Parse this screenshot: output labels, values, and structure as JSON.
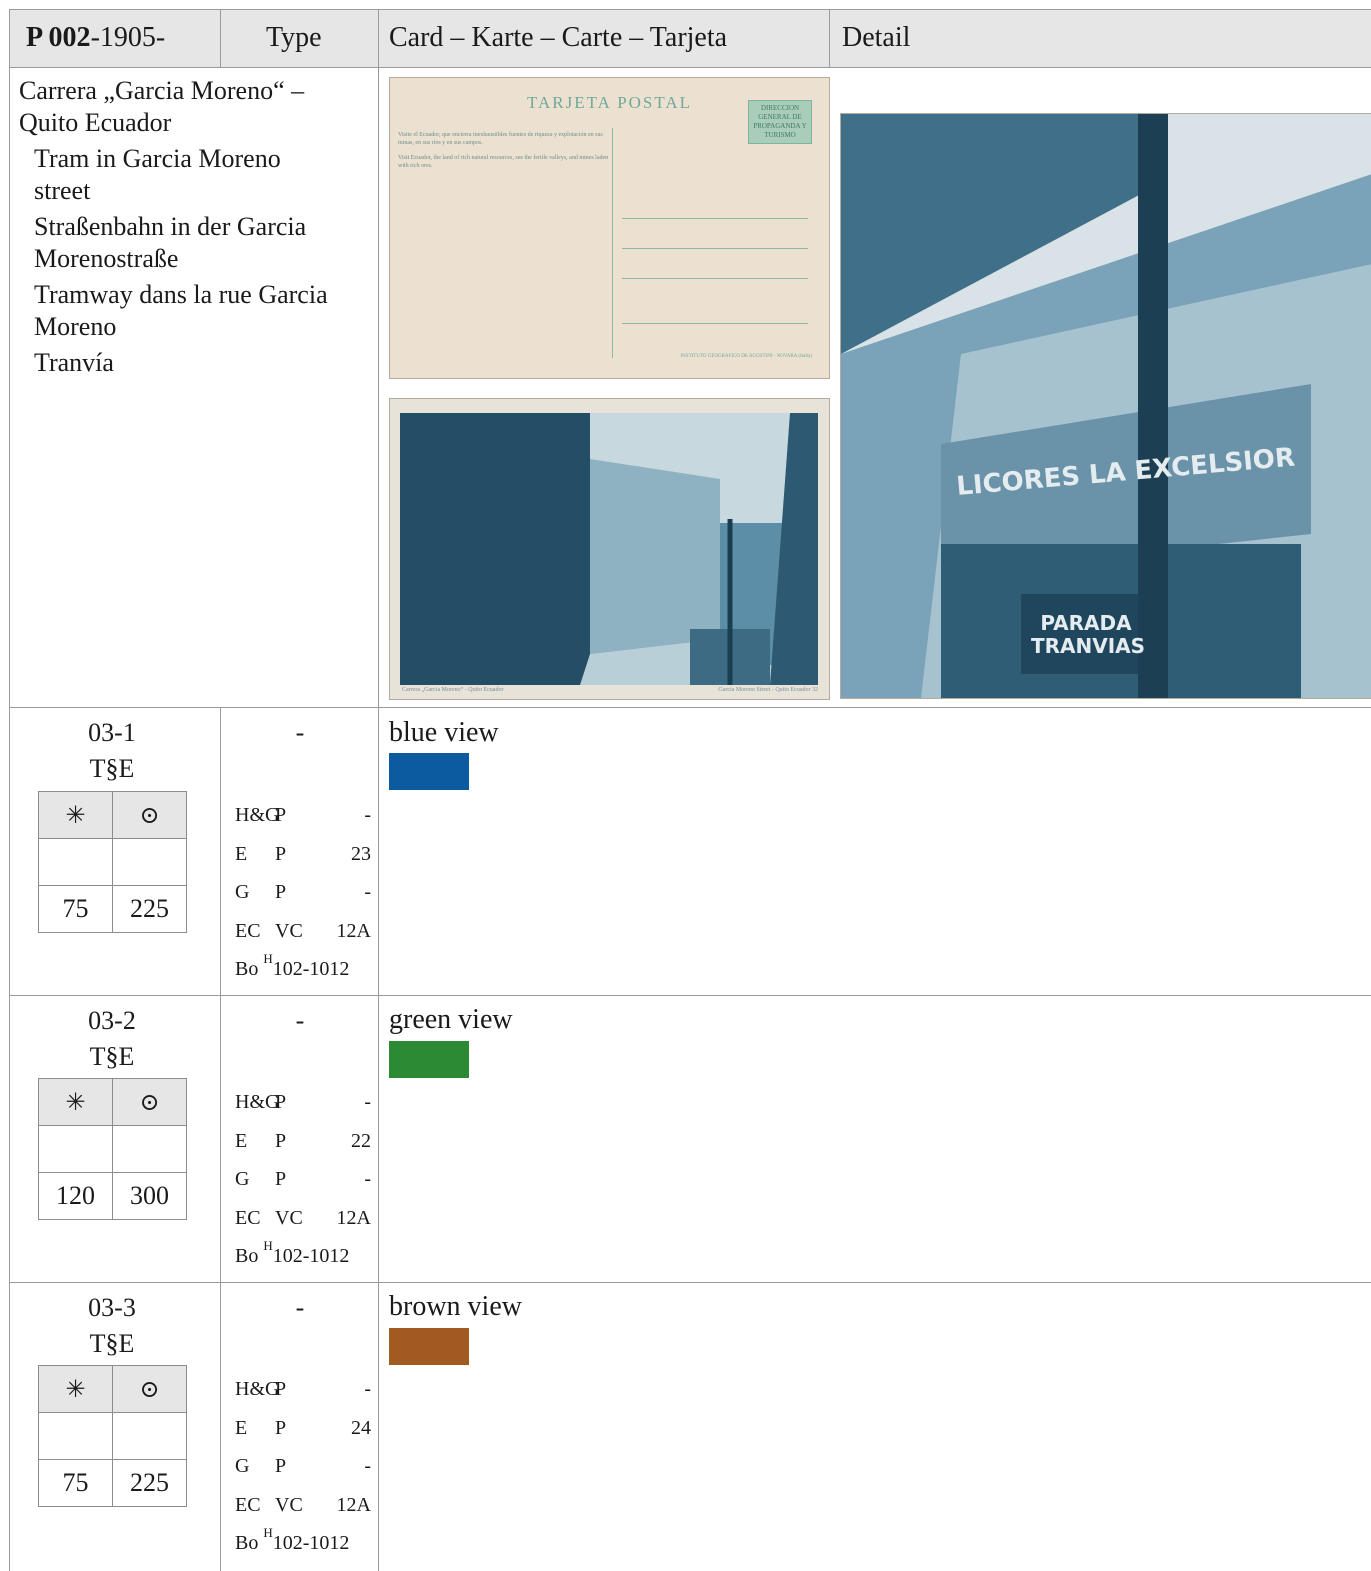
{
  "header": {
    "catalog_prefix": "P 002",
    "catalog_suffix": "-1905-",
    "type_label": "Type",
    "card_label": "Card – Karte – Carte – Tarjeta",
    "detail_label": "Detail"
  },
  "description": {
    "title_lines": [
      "Carrera „Garcia Moreno“ –",
      "Quito Ecuador"
    ],
    "translations": [
      [
        "Tram in Garcia Moreno",
        "street"
      ],
      [
        "Straßenbahn in der Garcia",
        "Morenostraße"
      ],
      [
        "Tramway dans la rue Garcia",
        "Moreno"
      ],
      [
        "Tranvía"
      ]
    ]
  },
  "postcard_back": {
    "title": "TARJETA POSTAL",
    "text_es": "Visite el Ecuador, que encierra inexhaustibles fuentes de riqueza y explotación en sus minas, en sus ríos y en sus campos.",
    "text_en": "Visit Ecuador, the land of rich natural resources, see the fertile valleys, and mines laden with rich ores.",
    "stamp_text": "DIRECCION GENERAL DE PROPAGANDA Y TURISMO",
    "footer": "INSTITUTO GEOGRAFICO DE AGOSTINI - NOVARA (Italia)"
  },
  "postcard_front": {
    "caption_left": "Carrera „Garcia Moreno“ - Quito Ecuador",
    "caption_right": "Garcia Moreno Street - Quito Ecuador 32"
  },
  "detail_image": {
    "sign_top": "LICORES LA EXCELSIOR",
    "sign_stop_1": "PARADA",
    "sign_stop_2": "TRANVIAS"
  },
  "variants": [
    {
      "code": "03-1",
      "code2": "T§E",
      "price_headers": [
        "✳",
        "⊙"
      ],
      "price_row1": [
        "",
        ""
      ],
      "prices": [
        "75",
        "225"
      ],
      "type_dash": "-",
      "refs": [
        {
          "a": "H&G",
          "b": "P",
          "c": "-"
        },
        {
          "a": "E",
          "b": "P",
          "c": "23"
        },
        {
          "a": "G",
          "b": "P",
          "c": "-"
        },
        {
          "a": "EC",
          "b": "VC",
          "c": "12A"
        }
      ],
      "bo_prefix": "Bo ",
      "bo_sup": "H",
      "bo_value": "102-1012",
      "label": "blue view",
      "color": "#0c5aa0"
    },
    {
      "code": "03-2",
      "code2": "T§E",
      "price_headers": [
        "✳",
        "⊙"
      ],
      "price_row1": [
        "",
        ""
      ],
      "prices": [
        "120",
        "300"
      ],
      "type_dash": "-",
      "refs": [
        {
          "a": "H&G",
          "b": "P",
          "c": "-"
        },
        {
          "a": "E",
          "b": "P",
          "c": "22"
        },
        {
          "a": "G",
          "b": "P",
          "c": "-"
        },
        {
          "a": "EC",
          "b": "VC",
          "c": "12A"
        }
      ],
      "bo_prefix": "Bo ",
      "bo_sup": "H",
      "bo_value": "102-1012",
      "label": "green view",
      "color": "#2c8a35"
    },
    {
      "code": "03-3",
      "code2": "T§E",
      "price_headers": [
        "✳",
        "⊙"
      ],
      "price_row1": [
        "",
        ""
      ],
      "prices": [
        "75",
        "225"
      ],
      "type_dash": "-",
      "refs": [
        {
          "a": "H&G",
          "b": "P",
          "c": "-"
        },
        {
          "a": "E",
          "b": "P",
          "c": "24"
        },
        {
          "a": "G",
          "b": "P",
          "c": "-"
        },
        {
          "a": "EC",
          "b": "VC",
          "c": "12A"
        }
      ],
      "bo_prefix": "Bo ",
      "bo_sup": "H",
      "bo_value": "102-1012",
      "label": "brown view",
      "color": "#a15a1f"
    }
  ]
}
